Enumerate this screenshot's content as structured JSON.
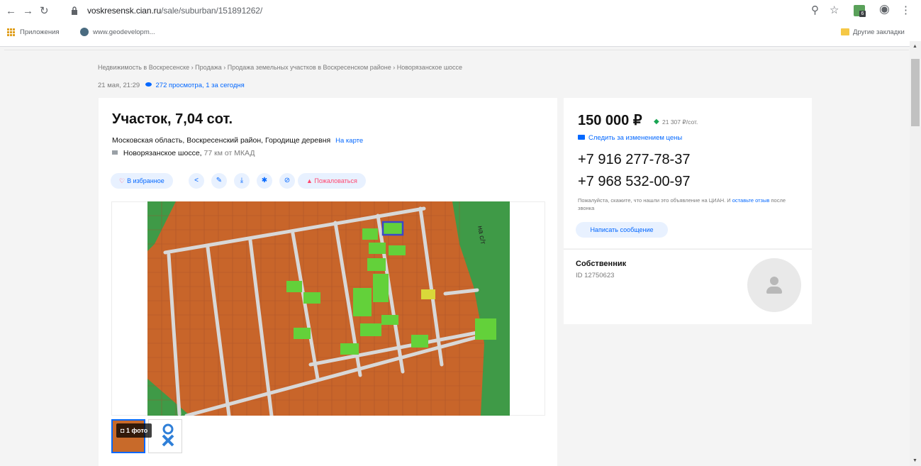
{
  "browser": {
    "url_host": "voskresensk.cian.ru",
    "url_path": "/sale/suburban/151891262/",
    "bookmarks": [
      "Приложения",
      "www.geodevelopm...",
      "Другие закладки"
    ]
  },
  "page": {
    "breadcrumb": "Недвижимость в Воскресенске  ›  Продажа  ›  Продажа земельных участков в Воскресенском районе  ›  Новорязанское шоссе",
    "published": "21 мая, 21:29",
    "views": "272 просмотра, 1 за сегодня",
    "title": "Участок, 7,04 сот.",
    "address": "Московская область, Воскресенский район, Городище деревня",
    "on_map": "На карте",
    "highway": "Новорязанское шоссе,",
    "distance": "77 км от МКАД",
    "favorite": "В избранное",
    "complain": "Пожаловаться",
    "photo_count": "1 фото"
  },
  "offer": {
    "price": "150 000 ₽",
    "price_per_unit": "21 307 ₽/сот.",
    "follow_price": "Следить за изменением цены",
    "phone1": "+7 916 277-78-37",
    "phone2": "+7 968 532-00-97",
    "note_text": "Пожалуйста, скажите, что нашли это объявление на ЦИАН. И",
    "note_link": "оставьте отзыв",
    "note_tail": "после звонка",
    "write_message": "Написать сообщение",
    "owner_label": "Собственник",
    "owner_id": "ID 12750623"
  },
  "colors": {
    "accent": "#0468ff",
    "plot_orange": "#c8652a",
    "plot_green": "#63d13a",
    "danger": "#ff4770"
  }
}
